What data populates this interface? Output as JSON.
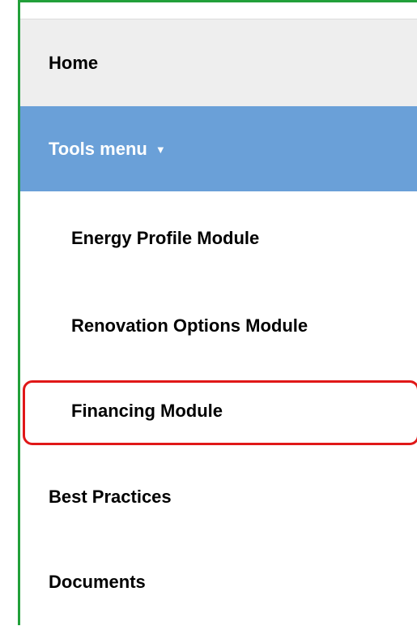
{
  "nav": {
    "home": "Home",
    "tools_menu": {
      "label": "Tools menu",
      "caret": "▼",
      "items": [
        {
          "label": "Energy Profile Module"
        },
        {
          "label": "Renovation Options Module"
        },
        {
          "label": "Financing Module"
        }
      ]
    },
    "best_practices": "Best Practices",
    "documents": "Documents"
  },
  "colors": {
    "active_bg": "#6aa0d8",
    "home_bg": "#eeeeee",
    "frame_border": "#22a03a",
    "highlight_border": "#e01818"
  }
}
